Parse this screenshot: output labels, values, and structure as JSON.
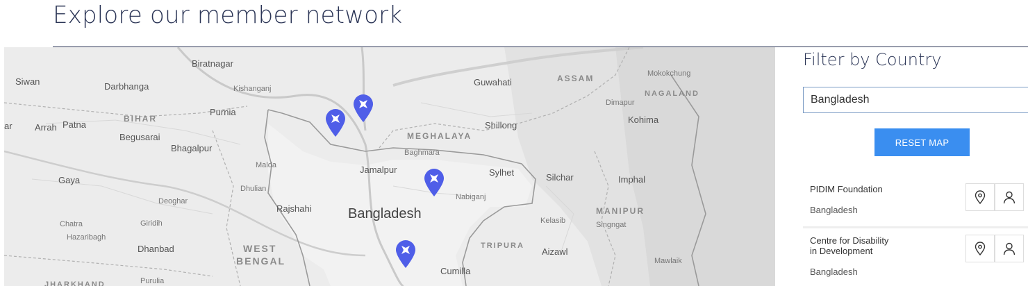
{
  "page": {
    "title": "Explore our member network"
  },
  "map": {
    "country_label": "Bangladesh",
    "region_labels": [
      "BIHAR",
      "MEGHALAYA",
      "ASSAM",
      "NAGALAND",
      "MANIPUR",
      "TRIPURA",
      "WEST",
      "BENGAL",
      "JHARKHAND"
    ],
    "city_labels": [
      "Biratnagar",
      "Siwan",
      "Darbhanga",
      "Kishanganj",
      "Purnia",
      "Arrah",
      "Patna",
      "Begusarai",
      "Bhagalpur",
      "Gaya",
      "Malda",
      "Dhulian",
      "Deoghar",
      "Giridih",
      "Rajshahi",
      "Chatra",
      "Hazaribagh",
      "Dhanbad",
      "Purulia",
      "Jamalpur",
      "Baghmara",
      "Guwahati",
      "Shillong",
      "Sylhet",
      "Nabiganj",
      "Silchar",
      "Imphal",
      "Dimapur",
      "Kohima",
      "Mokokchung",
      "Kelasib",
      "Singngat",
      "Aizawl",
      "Mawlaik",
      "Cumilla",
      "ar"
    ],
    "markers_count": 4
  },
  "sidebar": {
    "filter_heading": "Filter by Country",
    "country_input_value": "Bangladesh",
    "reset_label": "RESET MAP",
    "members": [
      {
        "name_line1": "PIDIM Foundation",
        "name_line2": "",
        "country": "Bangladesh"
      },
      {
        "name_line1": "Centre for Disability",
        "name_line2": "in Development",
        "country": "Bangladesh"
      }
    ]
  },
  "icons": {
    "location": "location-pin-icon",
    "person": "person-icon",
    "marker": "map-marker-icon"
  },
  "colors": {
    "title": "#2b3556",
    "marker": "#4f5ee8",
    "button": "#3a8ef0",
    "map_bg": "#ececec"
  }
}
